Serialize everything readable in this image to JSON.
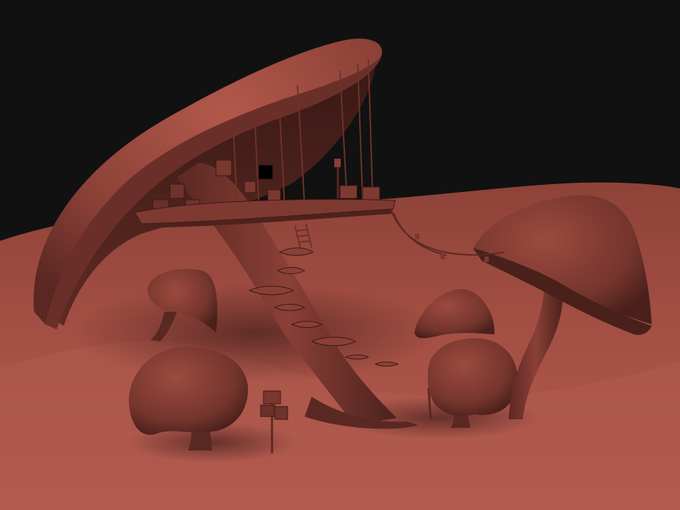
{
  "scene": {
    "subject": "mushroom-treehouse-sculpt",
    "colors": {
      "background": "#111111",
      "clay_light": "#b0574a",
      "clay_mid": "#8a4238",
      "clay_dark": "#4a201b",
      "clay_shadow": "#2a1210"
    },
    "objects": [
      "giant-mushroom-cap",
      "leaning-stalk",
      "wooden-platform",
      "crates",
      "hanging-ropes",
      "bracket-fungus-steps",
      "ladder",
      "small-mushroom-left",
      "round-mushroom-left",
      "small-mushroom-center",
      "round-mushroom-center",
      "tall-mushroom-right",
      "rope-bridge",
      "lantern-post",
      "ground-terrain"
    ]
  }
}
